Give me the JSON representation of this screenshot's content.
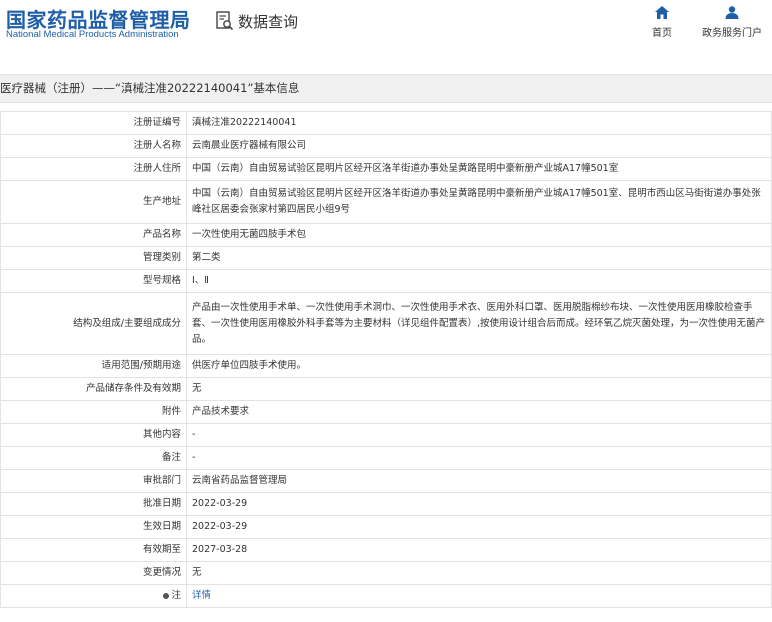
{
  "header": {
    "logo_cn": "国家药品监督管理局",
    "logo_en": "National Medical Products Administration",
    "query_label": "数据查询",
    "nav": [
      {
        "label": "首页",
        "icon": "home-icon"
      },
      {
        "label": "政务服务门户",
        "icon": "user-icon"
      }
    ]
  },
  "breadcrumb": "医疗器械（注册）——“滇械注准20222140041”基本信息",
  "colors": {
    "brand": "#1f5fa8",
    "link": "#2a62b0",
    "titlebar_bg": "#f0f0f0",
    "border": "#e3e3e3"
  },
  "rows": [
    {
      "label": "注册证编号",
      "value": "滇械注准20222140041"
    },
    {
      "label": "注册人名称",
      "value": "云南晨业医疗器械有限公司"
    },
    {
      "label": "注册人住所",
      "value": "中国（云南）自由贸易试验区昆明片区经开区洛羊街道办事处呈黄路昆明中豪新册产业城A17幢501室"
    },
    {
      "label": "生产地址",
      "value": "中国（云南）自由贸易试验区昆明片区经开区洛羊街道办事处呈黄路昆明中豪新册产业城A17幢501室、昆明市西山区马街街道办事处张峰社区居委会张家村第四居民小组9号"
    },
    {
      "label": "产品名称",
      "value": "一次性使用无菌四肢手术包"
    },
    {
      "label": "管理类别",
      "value": "第二类"
    },
    {
      "label": "型号规格",
      "value": "Ⅰ、Ⅱ"
    },
    {
      "label": "结构及组成/主要组成成分",
      "value": "产品由一次性使用手术单、一次性使用手术洞巾、一次性使用手术衣、医用外科口罩、医用脱脂棉纱布块、一次性使用医用橡胶检查手套、一次性使用医用橡胶外科手套等为主要材料（详见组件配置表）,按使用设计组合后而成。经环氧乙烷灭菌处理，为一次性使用无菌产品。"
    },
    {
      "label": "适用范围/预期用途",
      "value": "供医疗单位四肢手术使用。"
    },
    {
      "label": "产品储存条件及有效期",
      "value": "无"
    },
    {
      "label": "附件",
      "value": "产品技术要求"
    },
    {
      "label": "其他内容",
      "value": "-"
    },
    {
      "label": "备注",
      "value": "-"
    },
    {
      "label": "审批部门",
      "value": "云南省药品监督管理局"
    },
    {
      "label": "批准日期",
      "value": "2022-03-29"
    },
    {
      "label": "生效日期",
      "value": "2022-03-29"
    },
    {
      "label": "有效期至",
      "value": "2027-03-28"
    },
    {
      "label": "变更情况",
      "value": "无"
    },
    {
      "label": "注",
      "value": "详情"
    }
  ]
}
